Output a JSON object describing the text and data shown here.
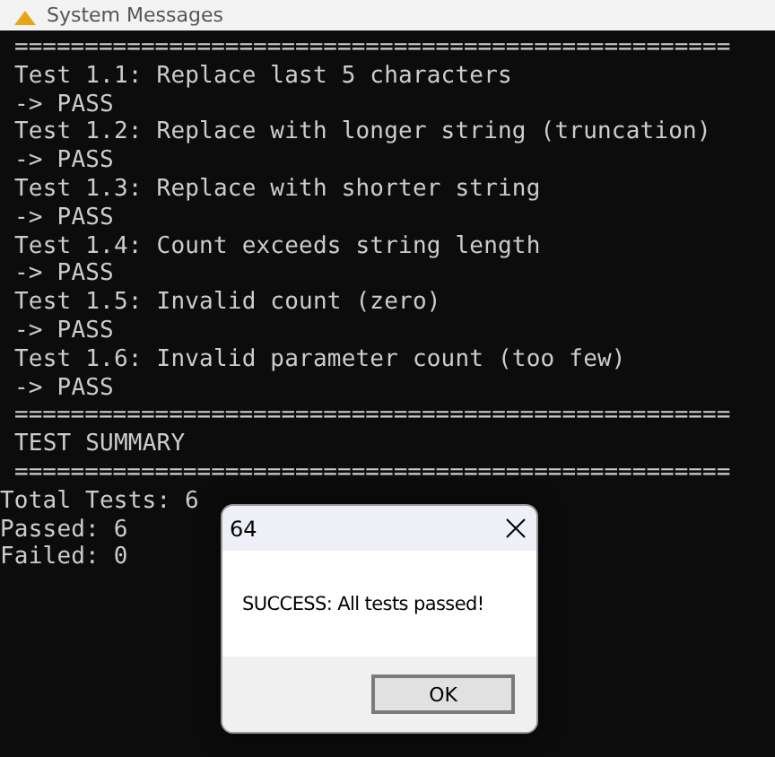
{
  "window": {
    "title": "System Messages"
  },
  "console": {
    "lines": [
      {
        "kind": "rule",
        "text": "==================================================="
      },
      {
        "kind": "test",
        "text": "Test 1.1: Replace last 5 characters"
      },
      {
        "kind": "result",
        "text": "-> PASS"
      },
      {
        "kind": "test",
        "text": "Test 1.2: Replace with longer string (truncation)"
      },
      {
        "kind": "result",
        "text": "-> PASS"
      },
      {
        "kind": "test",
        "text": "Test 1.3: Replace with shorter string"
      },
      {
        "kind": "result",
        "text": "-> PASS"
      },
      {
        "kind": "test",
        "text": "Test 1.4: Count exceeds string length"
      },
      {
        "kind": "result",
        "text": "-> PASS"
      },
      {
        "kind": "test",
        "text": "Test 1.5: Invalid count (zero)"
      },
      {
        "kind": "result",
        "text": "-> PASS"
      },
      {
        "kind": "test",
        "text": "Test 1.6: Invalid parameter count (too few)"
      },
      {
        "kind": "result",
        "text": "-> PASS"
      },
      {
        "kind": "rule",
        "text": "==================================================="
      },
      {
        "kind": "heading",
        "text": "TEST SUMMARY"
      },
      {
        "kind": "rule",
        "text": "==================================================="
      },
      {
        "kind": "summary",
        "text": "Total Tests: 6"
      },
      {
        "kind": "summary",
        "text": "Passed: 6"
      },
      {
        "kind": "summary",
        "text": "Failed: 0"
      }
    ]
  },
  "dialog": {
    "title": "64",
    "message": "SUCCESS: All tests passed!",
    "buttons": [
      "OK"
    ]
  }
}
